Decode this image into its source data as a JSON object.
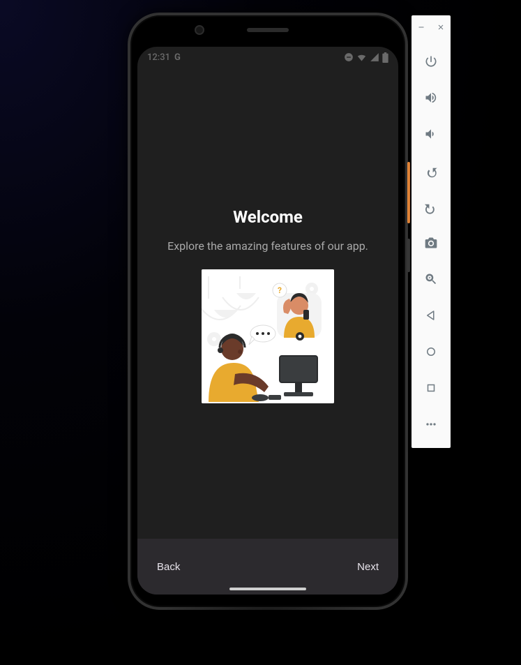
{
  "status_bar": {
    "time": "12:31",
    "left_indicator": "G"
  },
  "onboarding": {
    "title": "Welcome",
    "subtitle": "Explore the amazing features of our app.",
    "back_label": "Back",
    "next_label": "Next"
  },
  "toolbar": {
    "icons": [
      "power-icon",
      "volume-up-icon",
      "volume-down-icon",
      "rotate-left-icon",
      "rotate-right-icon",
      "camera-icon",
      "zoom-icon",
      "back-nav-icon",
      "home-nav-icon",
      "overview-nav-icon",
      "more-icon"
    ]
  },
  "colors": {
    "screen_bg": "#1f1f1f",
    "bottom_bar": "#2c2a2e",
    "accent_yellow": "#e2a72e",
    "toolbar_bg": "#fafafa",
    "toolbar_icon": "#6f7a82"
  }
}
